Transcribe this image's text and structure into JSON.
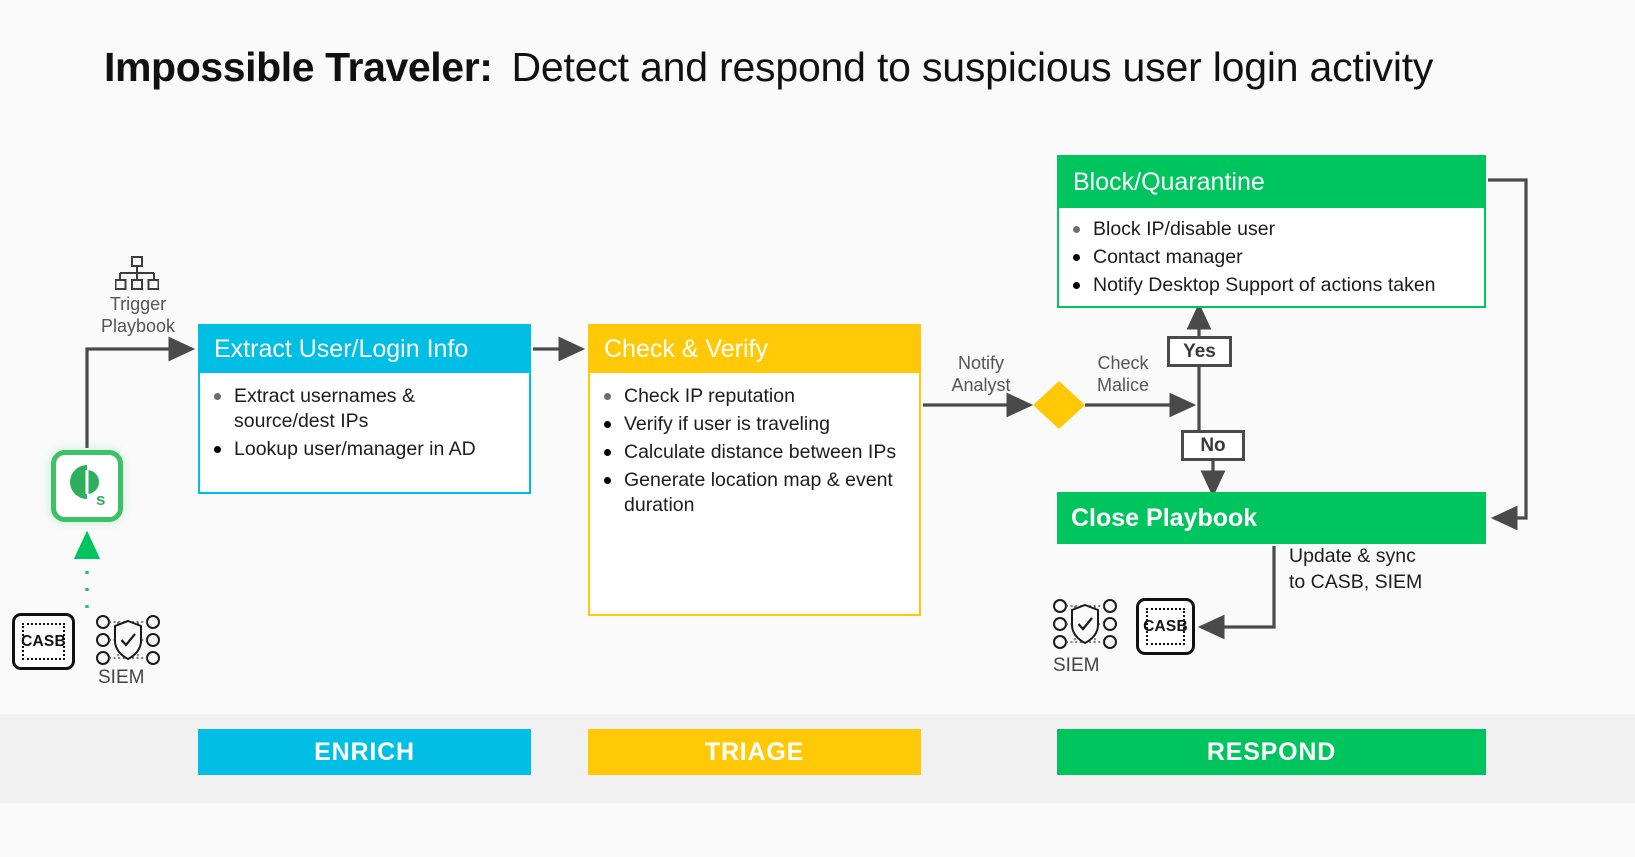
{
  "title": {
    "strong": "Impossible Traveler:",
    "rest": "Detect and respond to suspicious user login activity"
  },
  "colors": {
    "enrich": "#00BEE4",
    "triage": "#FFC907",
    "respond": "#00C55E",
    "wire": "#4a4a4a",
    "background": "#fafafa",
    "band": "#f1f1f1"
  },
  "trigger": {
    "icon": "org-chart-icon",
    "label": "Trigger\nPlaybook"
  },
  "platform": {
    "icon": "qualys-logo-icon"
  },
  "sources": {
    "casb_left_label": "CASB",
    "siem_left_label": "SIEM",
    "casb_right_label": "CASB",
    "siem_right_label": "SIEM"
  },
  "cards": {
    "enrich": {
      "title": "Extract User/Login Info",
      "items": [
        "Extract usernames & source/dest IPs",
        "Lookup user/manager in AD"
      ]
    },
    "triage": {
      "title": "Check & Verify",
      "items": [
        "Check IP reputation",
        "Verify if user is traveling",
        "Calculate distance between IPs",
        "Generate location map & event duration"
      ]
    },
    "block": {
      "title": "Block/Quarantine",
      "items": [
        "Block IP/disable user",
        "Contact manager",
        "Notify Desktop Support of actions taken"
      ]
    },
    "close": {
      "title": "Close Playbook"
    }
  },
  "wires": {
    "notify_analyst": "Notify\nAnalyst",
    "check_malice": "Check\nMalice",
    "yes": "Yes",
    "no": "No",
    "update_sync": "Update & sync\nto CASB, SIEM"
  },
  "phases": {
    "enrich": "ENRICH",
    "triage": "TRIAGE",
    "respond": "RESPOND"
  }
}
